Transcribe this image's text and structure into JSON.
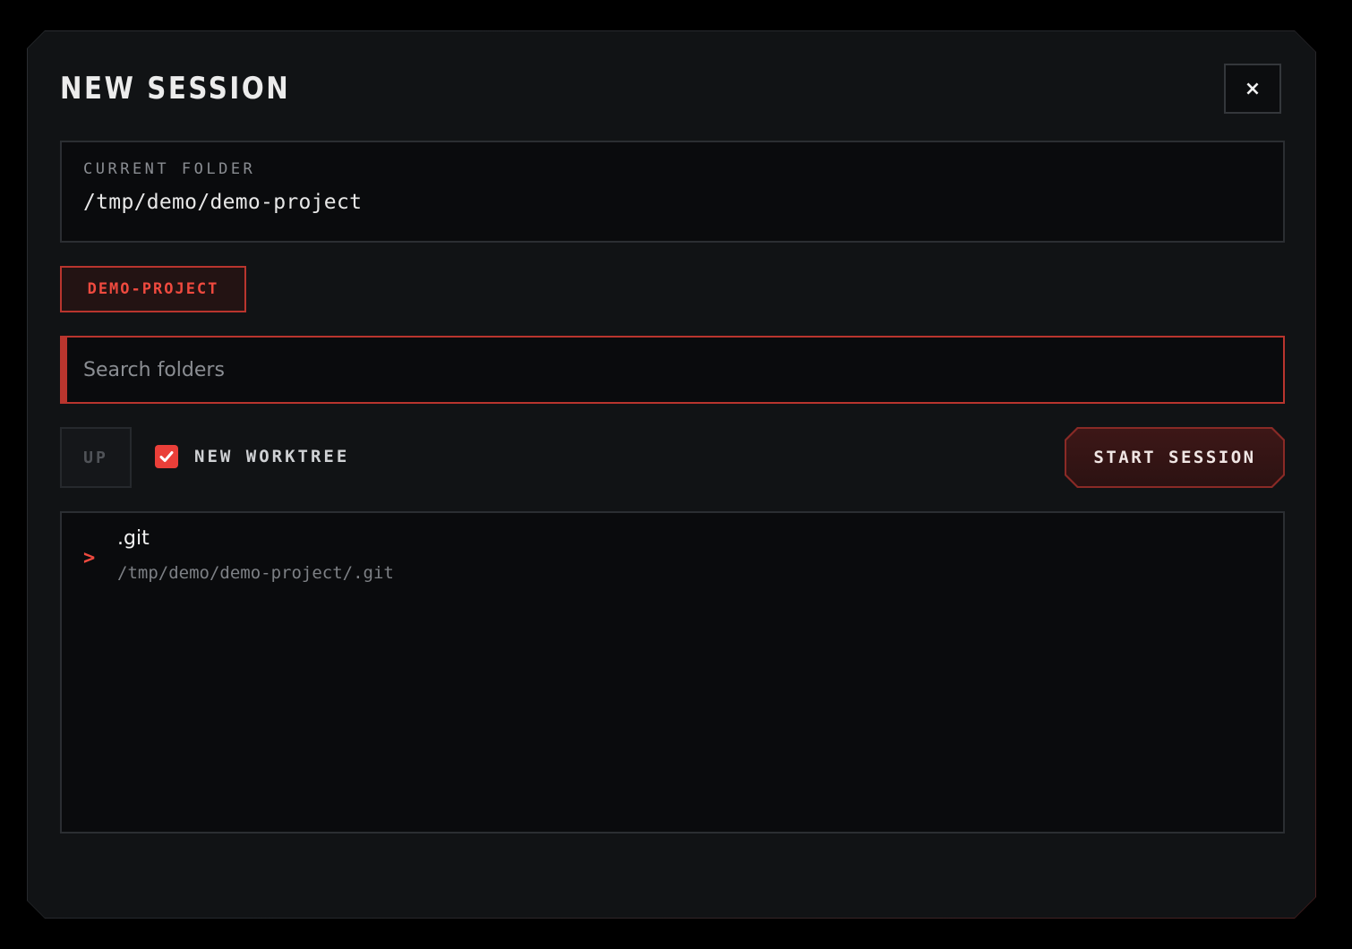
{
  "dialog": {
    "title": "NEW SESSION",
    "close_label": "×"
  },
  "current_folder": {
    "label": "CURRENT FOLDER",
    "path": "/tmp/demo/demo-project"
  },
  "project_badge": {
    "label": "DEMO-PROJECT"
  },
  "search": {
    "value": "",
    "placeholder": "Search folders"
  },
  "controls": {
    "up_label": "UP",
    "worktree_label": "NEW WORKTREE",
    "worktree_checked": true,
    "start_label": "START SESSION"
  },
  "folders": {
    "items": [
      {
        "name": ".git",
        "path": "/tmp/demo/demo-project/.git",
        "chevron": ">"
      }
    ]
  },
  "colors": {
    "accent": "#ef4a3f",
    "accent_border": "#b9352e",
    "background": "#111315",
    "panel": "#0a0b0d",
    "text": "#ececec"
  }
}
